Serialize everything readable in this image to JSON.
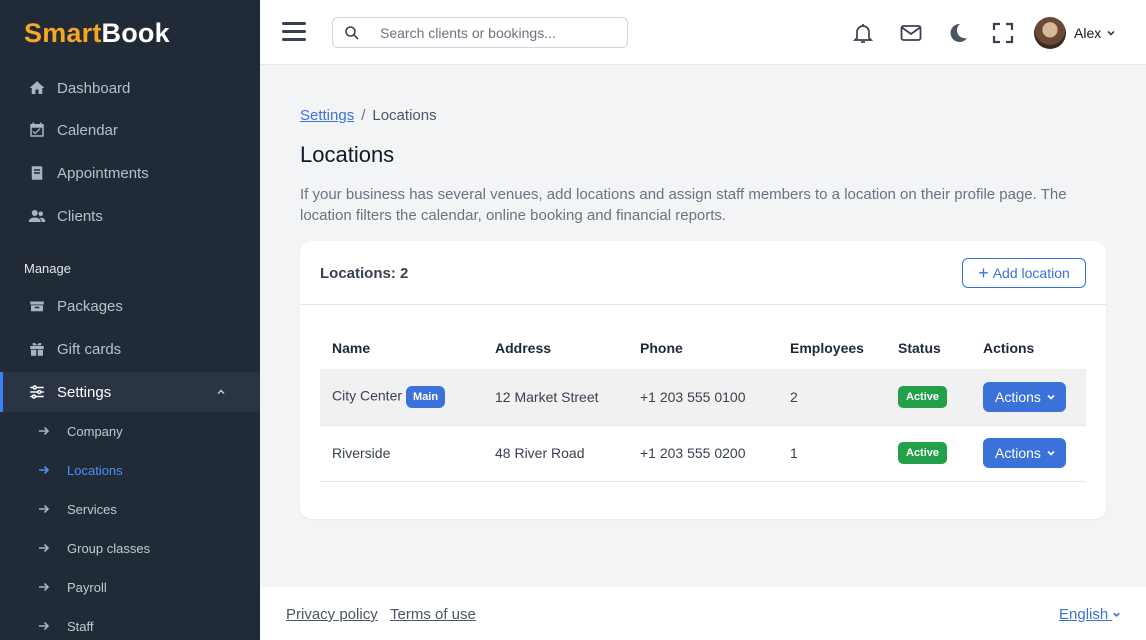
{
  "brand": {
    "part1": "Smart",
    "part2": "Book"
  },
  "sidebar": {
    "items": [
      {
        "label": "Dashboard",
        "icon": "home-icon"
      },
      {
        "label": "Calendar",
        "icon": "calendar-icon"
      },
      {
        "label": "Appointments",
        "icon": "book-icon"
      },
      {
        "label": "Clients",
        "icon": "users-icon"
      }
    ],
    "section_label": "Manage",
    "manage_items": [
      {
        "label": "Packages",
        "icon": "package-icon"
      },
      {
        "label": "Gift cards",
        "icon": "gift-icon"
      },
      {
        "label": "Settings",
        "icon": "sliders-icon"
      }
    ],
    "settings_sub": [
      "Company",
      "Locations",
      "Services",
      "Group classes",
      "Payroll",
      "Staff"
    ],
    "active_sub": "Locations"
  },
  "header": {
    "search_placeholder": "Search clients or bookings...",
    "user_name": "Alex"
  },
  "breadcrumb": {
    "parent": "Settings",
    "sep": "/",
    "current": "Locations"
  },
  "page": {
    "title": "Locations",
    "description": "If your business has several venues, add locations and assign staff members to a location on their profile page. The location filters the calendar, online booking and financial reports."
  },
  "card": {
    "count_label": "Locations: 2",
    "add_label": "Add location",
    "columns": [
      "Name",
      "Address",
      "Phone",
      "Employees",
      "Status",
      "Actions"
    ],
    "rows": [
      {
        "name": "City Center",
        "badge": "Main",
        "address": "12 Market Street",
        "phone": "+1 203 555 0100",
        "employees": "2",
        "status": "Active",
        "action": "Actions"
      },
      {
        "name": "Riverside",
        "badge": "",
        "address": "48 River Road",
        "phone": "+1 203 555 0200",
        "employees": "1",
        "status": "Active",
        "action": "Actions"
      }
    ]
  },
  "footer": {
    "privacy": "Privacy policy",
    "terms": "Terms of use",
    "language": "English"
  },
  "colors": {
    "accent": "#3b72d9",
    "sidebar_bg": "#212a37",
    "brand_orange": "#f5a623",
    "status_green": "#22a04a"
  }
}
